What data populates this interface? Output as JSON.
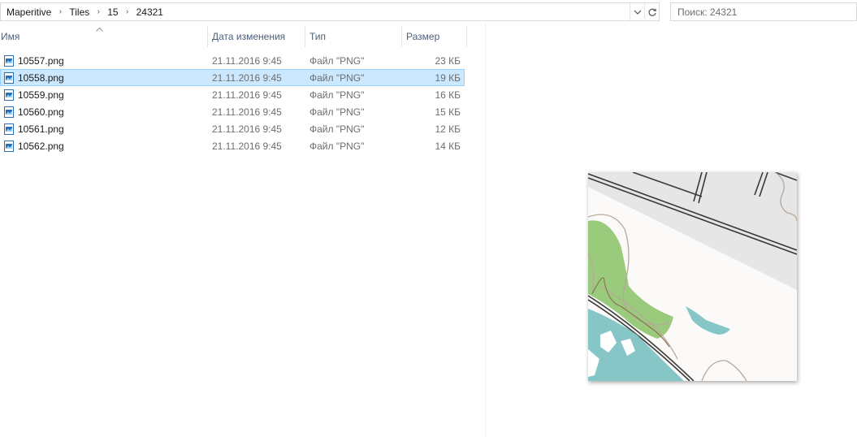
{
  "breadcrumb": {
    "items": [
      "Maperitive",
      "Tiles",
      "15",
      "24321"
    ],
    "separator": "›"
  },
  "search": {
    "placeholder": "Поиск: 24321"
  },
  "columns": {
    "name": "Имя",
    "date": "Дата изменения",
    "type": "Тип",
    "size": "Размер"
  },
  "files": [
    {
      "name": "10557.png",
      "date": "21.11.2016 9:45",
      "type": "Файл \"PNG\"",
      "size": "23 КБ"
    },
    {
      "name": "10558.png",
      "date": "21.11.2016 9:45",
      "type": "Файл \"PNG\"",
      "size": "19 КБ"
    },
    {
      "name": "10559.png",
      "date": "21.11.2016 9:45",
      "type": "Файл \"PNG\"",
      "size": "16 КБ"
    },
    {
      "name": "10560.png",
      "date": "21.11.2016 9:45",
      "type": "Файл \"PNG\"",
      "size": "15 КБ"
    },
    {
      "name": "10561.png",
      "date": "21.11.2016 9:45",
      "type": "Файл \"PNG\"",
      "size": "12 КБ"
    },
    {
      "name": "10562.png",
      "date": "21.11.2016 9:45",
      "type": "Файл \"PNG\"",
      "size": "14 КБ"
    }
  ],
  "selected_index": 1,
  "colors": {
    "selection_bg": "#cce8ff",
    "selection_border": "#99d1ff",
    "header_text": "#4c607a",
    "map_green": "#9acb7c",
    "map_water": "#86c6c7",
    "map_urban": "#e6e6e6"
  },
  "icons": {
    "file": "png-image-file-icon",
    "dropdown": "chevron-down-icon",
    "refresh": "refresh-icon",
    "sort": "sort-ascending-icon"
  }
}
